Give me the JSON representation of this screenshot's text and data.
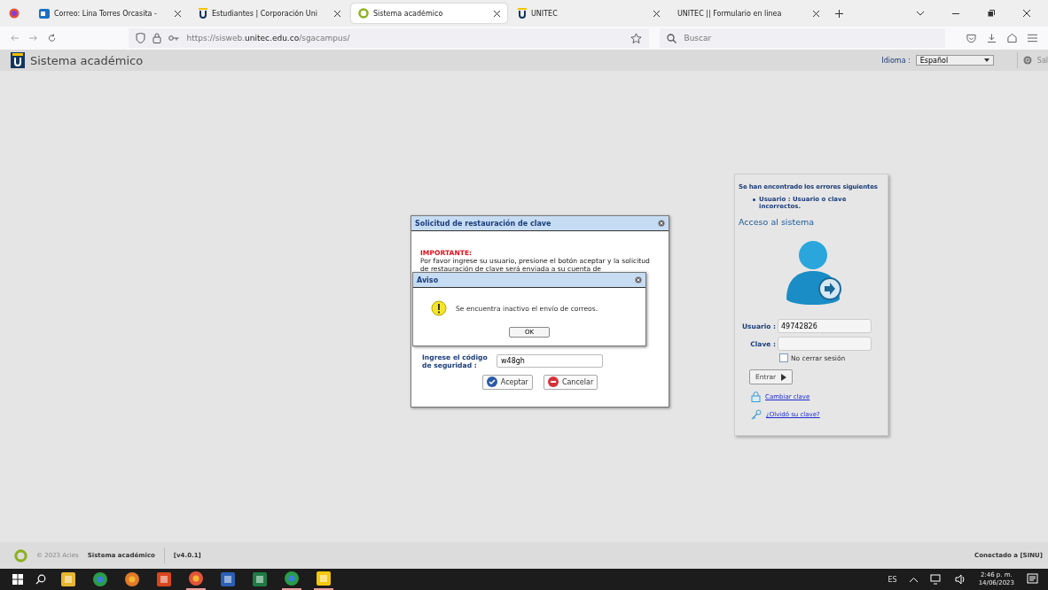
{
  "browser": {
    "tabs": [
      {
        "title": "Correo: Lina Torres Orcasita -",
        "kind": "mail",
        "selected": false
      },
      {
        "title": "Estudiantes | Corporación Uni",
        "kind": "unitec",
        "selected": false
      },
      {
        "title": "Sistema académico",
        "kind": "sinu",
        "selected": true
      },
      {
        "title": "UNITEC",
        "kind": "unitec",
        "selected": false
      },
      {
        "title": "UNITEC || Formulario en linea",
        "kind": "none",
        "selected": false
      }
    ],
    "url": "https://sisweb.**unitec.edu.co**/sgacampus/",
    "search_placeholder": "Buscar"
  },
  "app_header": {
    "title": "Sistema académico",
    "language_label": "Idioma :",
    "language": "Español",
    "logout": "Sal"
  },
  "restore_dialog": {
    "title": "Solicitud de restauración de clave",
    "important": "IMPORTANTE:",
    "text": "Por favor ingrese su usuario, presione el botón aceptar y la solicitud de restauración de clave será enviada a su cuenta de",
    "code_label": "Ingrese el código de seguridad :",
    "code_value": "w48gh",
    "accept": "Aceptar",
    "cancel": "Cancelar"
  },
  "alert_dialog": {
    "title": "Aviso",
    "message": "Se encuentra inactivo el envío de correos.",
    "ok": "OK"
  },
  "login": {
    "errors_title": "Se han encontrado los errores siguientes",
    "errors": [
      "Usuario : Usuario o clave incorrectos."
    ],
    "title": "Acceso al sistema",
    "user_label": "Usuario :",
    "user_value": "49742826",
    "password_label": "Clave :",
    "remember": {
      "label": "No cerrar sesión",
      "checked": false
    },
    "submit": "Entrar",
    "change_password": "Cambiar clave",
    "forgot_password": "¿Olvidó su clave?"
  },
  "footer": {
    "copyright": "© 2023 Acies",
    "app": "Sistema académico",
    "version": "[v4.0.1]",
    "status": "Conectado a [SINU]"
  },
  "taskbar": {
    "apps": [
      {
        "kind": "explorer",
        "active": false
      },
      {
        "kind": "chrome",
        "active": false
      },
      {
        "kind": "orange",
        "active": false
      },
      {
        "kind": "pdf",
        "active": false
      },
      {
        "kind": "firefox",
        "active": true
      },
      {
        "kind": "word",
        "active": false
      },
      {
        "kind": "excel",
        "active": false
      },
      {
        "kind": "chrome",
        "active": true
      },
      {
        "kind": "notes",
        "active": true
      }
    ],
    "language": "ES",
    "time": "2:46 p. m.",
    "date": "14/06/2023"
  }
}
